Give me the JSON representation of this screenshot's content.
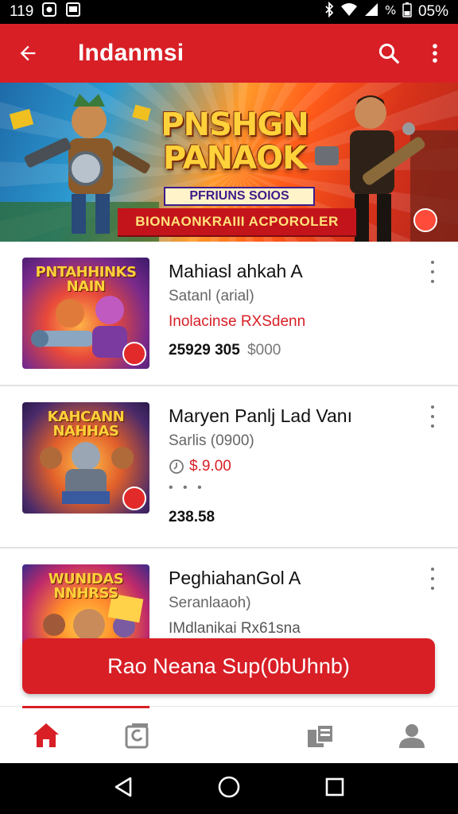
{
  "status_bar": {
    "time": "119",
    "battery": "05%"
  },
  "app_bar": {
    "title": "Indanmsi",
    "back_icon": "arrow-back-icon",
    "search_icon": "search-icon",
    "more_icon": "more-vert-icon"
  },
  "banner": {
    "title": "PNSHGN PANAOK",
    "subtitle": "PFRIUNS SOIOS",
    "strip": "BIONAONKRAIII ACPOROLER"
  },
  "items": [
    {
      "thumb_title": "PNTAHHINKS NAIN",
      "title": "Mahiasl ahkah A",
      "subtitle": "Satanl (arial)",
      "meta": "Inolacinse RXSdenn",
      "price_main": "25929 305",
      "price_extra": "$000"
    },
    {
      "thumb_title": "KAHCANN NAHHAS",
      "title": "Maryen Panlj Lad Vanı",
      "subtitle": "Sarlis (0900)",
      "meta": "$.9.00",
      "meta_dots": "• • •",
      "price_main": "238.58"
    },
    {
      "thumb_title": "WUNIDAS NNHRSS",
      "title": "PeghiahanGol A",
      "subtitle": "Seranlaaoh)",
      "meta": "IMdlanikai Rx61sna"
    }
  ],
  "cta": {
    "label": "Rao Neana Sup(0bUhnb)"
  },
  "bottom_nav": {
    "items": [
      "home-icon",
      "library-icon",
      "collections-icon",
      "account-icon"
    ],
    "active": "home-icon"
  },
  "colors": {
    "primary": "#d81f26",
    "text": "#111111",
    "secondary_text": "#666666"
  }
}
